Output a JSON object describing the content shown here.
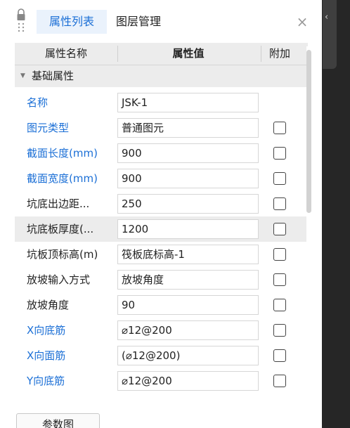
{
  "tabs": [
    {
      "label": "属性列表",
      "active": true
    },
    {
      "label": "图层管理",
      "active": false
    }
  ],
  "close_glyph": "×",
  "side_glyph": "‹",
  "columns": [
    "属性名称",
    "属性值",
    "附加"
  ],
  "group": {
    "label": "基础属性",
    "expanded": true
  },
  "rows": [
    {
      "name": "名称",
      "value": "JSK-1",
      "checkbox": false,
      "name_color": "blue"
    },
    {
      "name": "图元类型",
      "value": "普通图元",
      "checkbox": true,
      "checked": false,
      "name_color": "blue"
    },
    {
      "name": "截面长度(mm)",
      "value": "900",
      "checkbox": true,
      "checked": false,
      "name_color": "blue"
    },
    {
      "name": "截面宽度(mm)",
      "value": "900",
      "checkbox": true,
      "checked": false,
      "name_color": "blue"
    },
    {
      "name": "坑底出边距...",
      "value": "250",
      "checkbox": true,
      "checked": false,
      "name_color": "dark"
    },
    {
      "name": "坑底板厚度(...",
      "value": "1200",
      "checkbox": true,
      "checked": false,
      "name_color": "dark",
      "highlight": true
    },
    {
      "name": "坑板顶标高(m)",
      "value": "筏板底标高-1",
      "checkbox": true,
      "checked": false,
      "name_color": "dark"
    },
    {
      "name": "放坡输入方式",
      "value": "放坡角度",
      "checkbox": true,
      "checked": false,
      "name_color": "dark"
    },
    {
      "name": "放坡角度",
      "value": "90",
      "checkbox": true,
      "checked": false,
      "name_color": "dark"
    },
    {
      "name": "X向底筋",
      "value": "⌀12@200",
      "checkbox": true,
      "checked": false,
      "name_color": "blue"
    },
    {
      "name": "X向面筋",
      "value": "(⌀12@200)",
      "checkbox": true,
      "checked": false,
      "name_color": "blue"
    },
    {
      "name": "Y向底筋",
      "value": "⌀12@200",
      "checkbox": true,
      "checked": false,
      "name_color": "blue"
    }
  ],
  "button_label": "参数图",
  "colors": {
    "accent": "#1b6fd6",
    "header_bg": "#ececec",
    "tab_active_bg": "#eaf2fc",
    "side_bg": "#262626"
  },
  "icons": {
    "lock": "lock-icon",
    "close": "close-icon",
    "collapse_triangle": "triangle-down-icon",
    "side_chevron": "chevron-left-icon"
  }
}
